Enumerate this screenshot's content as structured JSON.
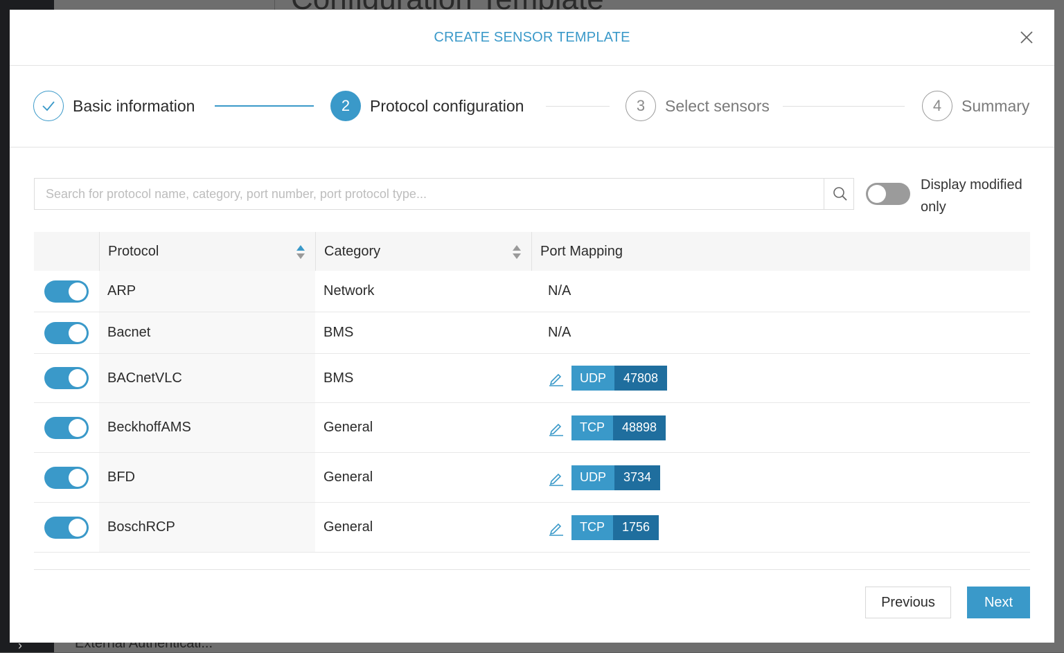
{
  "background": {
    "heading": "Configuration Template",
    "footer_text": "External Authenticati..."
  },
  "modal": {
    "title": "CREATE SENSOR TEMPLATE"
  },
  "stepper": {
    "steps": [
      {
        "number": "1",
        "label": "Basic information",
        "state": "done"
      },
      {
        "number": "2",
        "label": "Protocol configuration",
        "state": "active"
      },
      {
        "number": "3",
        "label": "Select sensors",
        "state": "todo"
      },
      {
        "number": "4",
        "label": "Summary",
        "state": "todo"
      }
    ]
  },
  "search": {
    "placeholder": "Search for protocol name, category, port number, port protocol type...",
    "value": ""
  },
  "filter": {
    "label": "Display modified only",
    "enabled": false
  },
  "table": {
    "columns": [
      "Protocol",
      "Category",
      "Port Mapping"
    ],
    "rows": [
      {
        "enabled": true,
        "protocol": "ARP",
        "category": "Network",
        "port_text": "N/A"
      },
      {
        "enabled": true,
        "protocol": "Bacnet",
        "category": "BMS",
        "port_text": "N/A"
      },
      {
        "enabled": true,
        "protocol": "BACnetVLC",
        "category": "BMS",
        "port_type": "UDP",
        "port_number": "47808"
      },
      {
        "enabled": true,
        "protocol": "BeckhoffAMS",
        "category": "General",
        "port_type": "TCP",
        "port_number": "48898"
      },
      {
        "enabled": true,
        "protocol": "BFD",
        "category": "General",
        "port_type": "UDP",
        "port_number": "3734"
      },
      {
        "enabled": true,
        "protocol": "BoschRCP",
        "category": "General",
        "port_type": "TCP",
        "port_number": "1756"
      }
    ]
  },
  "buttons": {
    "previous": "Previous",
    "next": "Next"
  },
  "colors": {
    "accent": "#3a99c9",
    "port_number_bg": "#1f6e9e"
  }
}
